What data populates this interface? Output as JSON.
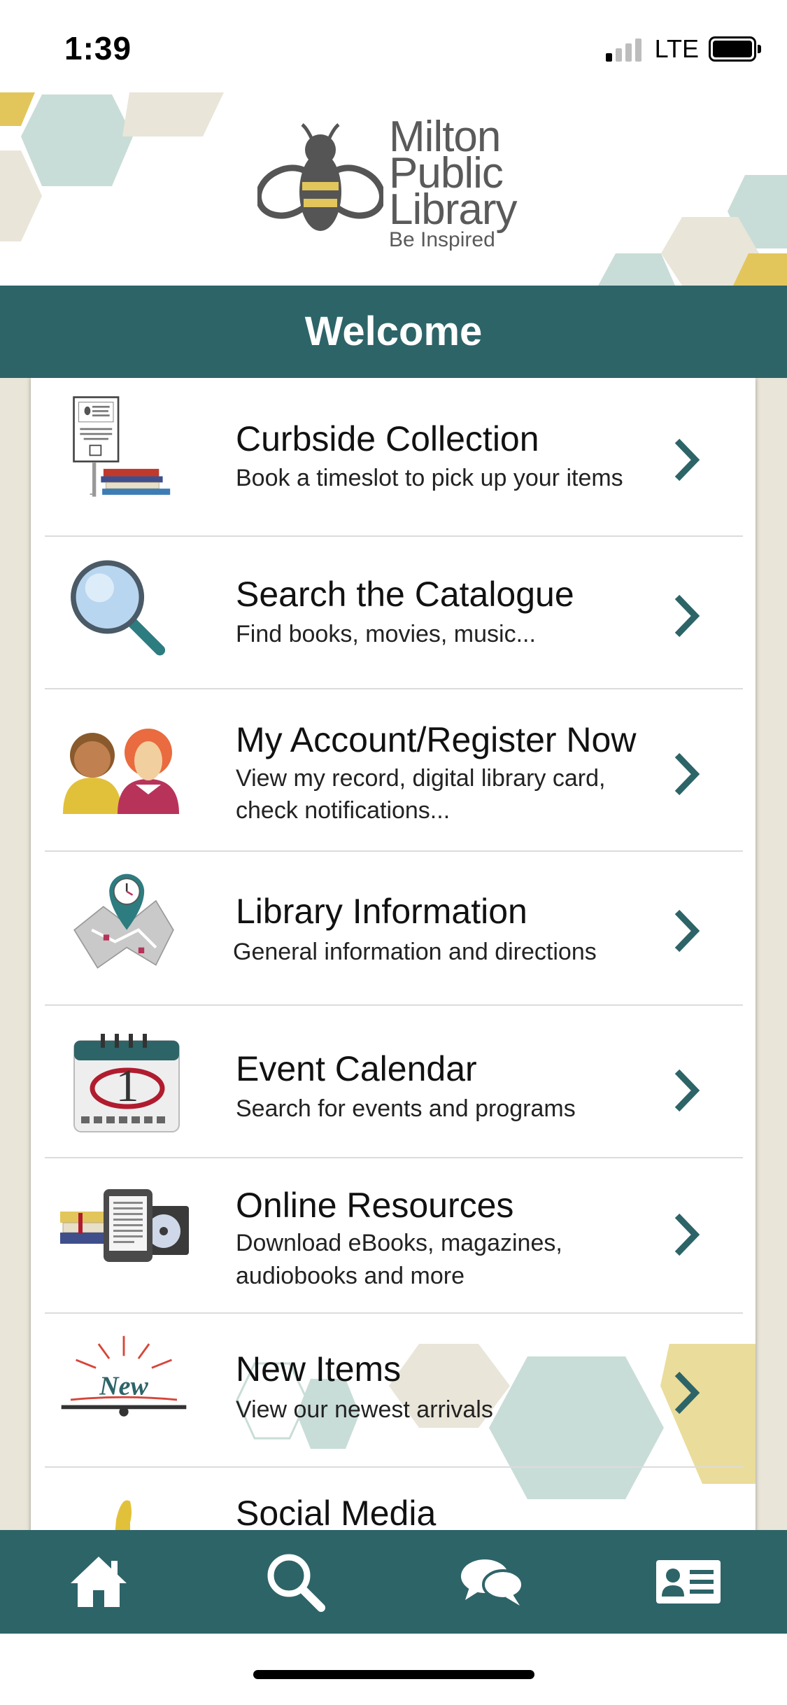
{
  "status_bar": {
    "time": "1:39",
    "network": "LTE",
    "signal_bars_on": 1,
    "signal_bars_total": 4
  },
  "header": {
    "logo_lines": [
      "Milton",
      "Public",
      "Library"
    ],
    "tagline": "Be Inspired"
  },
  "welcome": {
    "title": "Welcome"
  },
  "menu": [
    {
      "title": "Curbside Collection",
      "subtitle": [
        "Book a timeslot to pick up your items"
      ],
      "icon": "curbside-sign-icon"
    },
    {
      "title": "Search the Catalogue",
      "subtitle": [
        "Find books, movies, music..."
      ],
      "icon": "magnifying-glass-icon"
    },
    {
      "title": "My Account/Register Now",
      "subtitle": [
        "View my record, digital library card,",
        "check notifications..."
      ],
      "icon": "people-icon"
    },
    {
      "title": "Library Information",
      "subtitle": [
        "General information and directions"
      ],
      "icon": "map-pin-icon"
    },
    {
      "title": "Event Calendar",
      "subtitle": [
        "Search for events and programs"
      ],
      "icon": "calendar-icon"
    },
    {
      "title": "Online Resources",
      "subtitle": [
        "Download eBooks, magazines,",
        "audiobooks and more"
      ],
      "icon": "ereader-books-icon"
    },
    {
      "title": "New Items",
      "subtitle": [
        "View our newest arrivals"
      ],
      "icon": "new-book-icon"
    },
    {
      "title": "Social Media",
      "subtitle": [],
      "icon": "thumbs-up-icon"
    }
  ],
  "tabs": [
    {
      "name": "home",
      "icon": "home-icon"
    },
    {
      "name": "search",
      "icon": "search-icon"
    },
    {
      "name": "chat",
      "icon": "chat-bubbles-icon"
    },
    {
      "name": "card",
      "icon": "library-card-icon"
    }
  ],
  "colors": {
    "teal": "#2d6468",
    "gold": "#e2c65c",
    "hex_light": "#c9ddd8",
    "hex_beige": "#e9e5d9"
  }
}
